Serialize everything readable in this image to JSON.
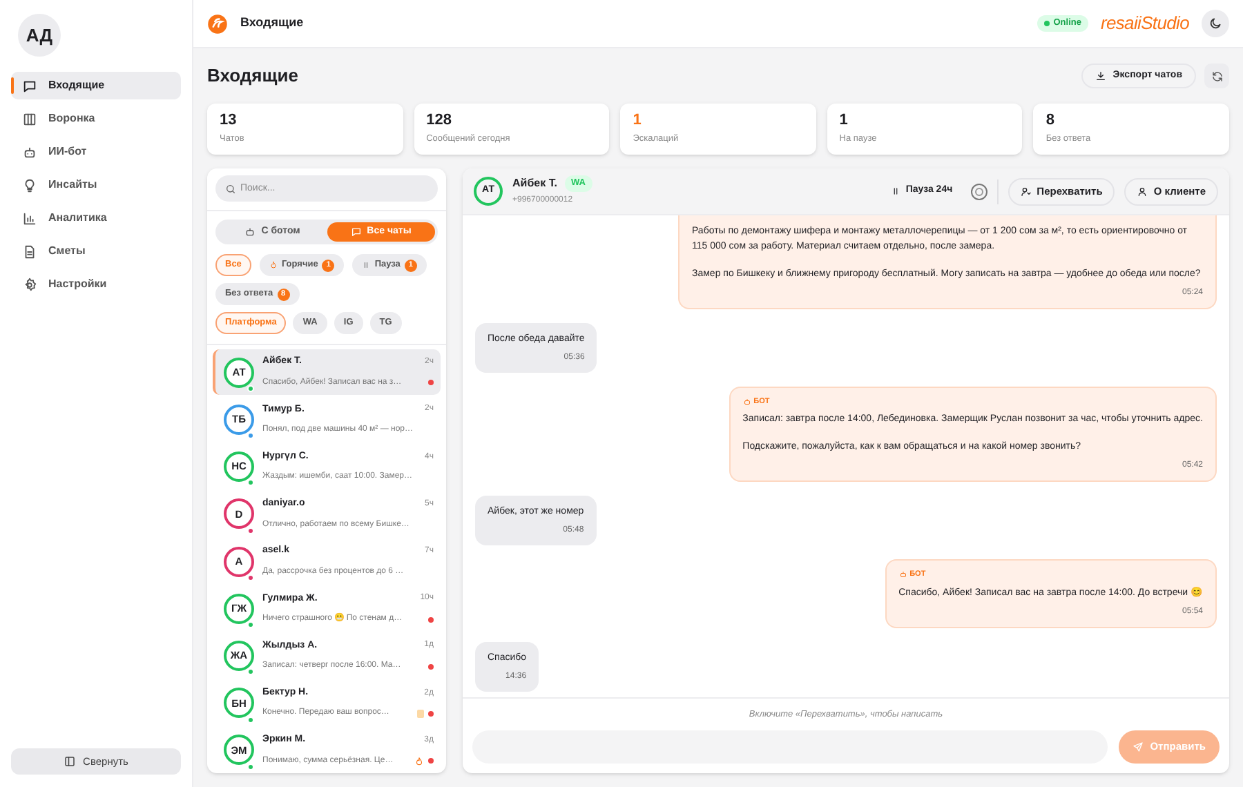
{
  "user": {
    "initials": "АД"
  },
  "nav": [
    {
      "label": "Входящие",
      "selected": true
    },
    {
      "label": "Воронка",
      "selected": false
    },
    {
      "label": "ИИ-бот",
      "selected": false
    },
    {
      "label": "Инсайты",
      "selected": false
    },
    {
      "label": "Аналитика",
      "selected": false
    },
    {
      "label": "Сметы",
      "selected": false
    },
    {
      "label": "Настройки",
      "selected": false
    }
  ],
  "collapse_button": "Свернуть",
  "header": {
    "title": "Входящие",
    "status": "Online",
    "brand": "resaiiStudio"
  },
  "page": {
    "title": "Входящие",
    "export_button": "Экспорт чатов"
  },
  "stats": [
    {
      "value": "13",
      "label": "Чатов",
      "highlight": false
    },
    {
      "value": "128",
      "label": "Сообщений сегодня",
      "highlight": false
    },
    {
      "value": "1",
      "label": "Эскалаций",
      "highlight": true
    },
    {
      "value": "1",
      "label": "На паузе",
      "highlight": false
    },
    {
      "value": "8",
      "label": "Без ответа",
      "highlight": false
    }
  ],
  "search": {
    "placeholder": "Поиск..."
  },
  "modes": [
    {
      "label": "С ботом",
      "selected": false
    },
    {
      "label": "Все чаты",
      "selected": true
    }
  ],
  "filters": [
    {
      "label": "Все",
      "selected": true
    },
    {
      "label": "Горячие",
      "count": "1",
      "selected": false
    },
    {
      "label": "Пауза",
      "count": "1",
      "selected": false
    },
    {
      "label": "Без ответа",
      "count": "8",
      "selected": false
    }
  ],
  "platforms": [
    {
      "label": "Платформа",
      "selected": true
    },
    {
      "label": "WA",
      "selected": false
    },
    {
      "label": "IG",
      "selected": false
    },
    {
      "label": "TG",
      "selected": false
    }
  ],
  "chats": [
    {
      "initials": "АТ",
      "name": "Айбек Т.",
      "time": "2ч",
      "preview": "Спасибо, Айбек! Записал вас на з…",
      "color": "#22c55e",
      "unread": true,
      "paused": false,
      "hot": false,
      "selected": true
    },
    {
      "initials": "ТБ",
      "name": "Тимур Б.",
      "time": "2ч",
      "preview": "Понял, под две машины 40 м² — нор…",
      "color": "#3b9be8",
      "unread": false,
      "paused": false,
      "hot": false,
      "selected": false
    },
    {
      "initials": "НС",
      "name": "Нургүл С.",
      "time": "4ч",
      "preview": "Жаздым: ишемби, саат 10:00. Замер…",
      "color": "#22c55e",
      "unread": false,
      "paused": false,
      "hot": false,
      "selected": false
    },
    {
      "initials": "D",
      "name": "daniyar.o",
      "time": "5ч",
      "preview": "Отлично, работаем по всему Бишке…",
      "color": "#e0356a",
      "unread": false,
      "paused": false,
      "hot": false,
      "selected": false
    },
    {
      "initials": "A",
      "name": "asel.k",
      "time": "7ч",
      "preview": "Да, рассрочка без процентов до 6 …",
      "color": "#e0356a",
      "unread": false,
      "paused": false,
      "hot": false,
      "selected": false
    },
    {
      "initials": "ГЖ",
      "name": "Гулмира Ж.",
      "time": "10ч",
      "preview": "Ничего страшного 😬 По стенам д…",
      "color": "#22c55e",
      "unread": true,
      "paused": false,
      "hot": false,
      "selected": false
    },
    {
      "initials": "ЖА",
      "name": "Жылдыз А.",
      "time": "1д",
      "preview": "Записал: четверг после 16:00. Ма…",
      "color": "#22c55e",
      "unread": true,
      "paused": false,
      "hot": false,
      "selected": false
    },
    {
      "initials": "БН",
      "name": "Бектур Н.",
      "time": "2д",
      "preview": "Конечно. Передаю ваш вопрос…",
      "color": "#22c55e",
      "unread": true,
      "paused": true,
      "hot": false,
      "selected": false
    },
    {
      "initials": "ЭМ",
      "name": "Эркин М.",
      "time": "3д",
      "preview": "Понимаю, сумма серьёзная. Це…",
      "color": "#22c55e",
      "unread": true,
      "paused": false,
      "hot": true,
      "selected": false
    }
  ],
  "conversation": {
    "initials": "АТ",
    "name": "Айбек Т.",
    "platform": "WA",
    "phone": "+996700000012",
    "pause": "Пауза 24ч",
    "takeover_button": "Перехватить",
    "client_button": "О клиенте"
  },
  "messages": [
    {
      "kind": "out",
      "paragraphs": [
        "Работы по демонтажу шифера и монтажу металлочерепицы — от 1 200 сом за м², то есть ориентировочно от 115 000 сом за работу. Материал считаем отдельно, после замера.",
        "Замер по Бишкеку и ближнему пригороду бесплатный. Могу записать на завтра — удобнее до обеда или после?"
      ],
      "time": "05:24"
    },
    {
      "kind": "in",
      "paragraphs": [
        "После обеда давайте"
      ],
      "time": "05:36"
    },
    {
      "kind": "out",
      "label": "БОТ",
      "paragraphs": [
        "Записал: завтра после 14:00, Лебединовка. Замерщик Руслан позвонит за час, чтобы уточнить адрес.",
        "Подскажите, пожалуйста, как к вам обращаться и на какой номер звонить?"
      ],
      "time": "05:42"
    },
    {
      "kind": "in",
      "paragraphs": [
        "Айбек, этот же номер"
      ],
      "time": "05:48"
    },
    {
      "kind": "out",
      "label": "БОТ",
      "paragraphs": [
        "Спасибо, Айбек! Записал вас на завтра после 14:00. До встречи 😊"
      ],
      "time": "05:54"
    },
    {
      "kind": "in",
      "paragraphs": [
        "Спасибо"
      ],
      "time": "14:36"
    }
  ],
  "composer": {
    "hint": "Включите «Перехватить», чтобы написать",
    "disabled": true,
    "send_button": "Отправить"
  }
}
